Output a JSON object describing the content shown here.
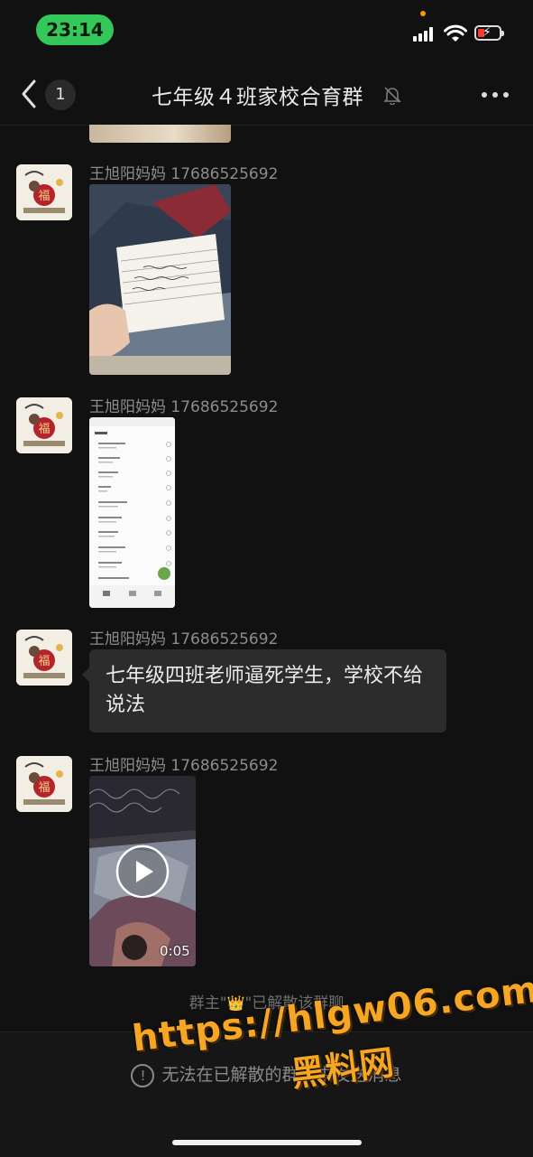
{
  "status_bar": {
    "time": "23:14",
    "signal_icon": "cellular-signal-icon",
    "wifi_icon": "wifi-icon",
    "battery_icon": "battery-charging-icon",
    "battery_color": "#ff3b30",
    "time_pill_color": "#34c759"
  },
  "nav": {
    "back_icon": "chevron-left-icon",
    "unread_count": "1",
    "title": "七年级４班家校合育群",
    "mute_icon": "bell-muted-icon",
    "more_icon": "more-dots-icon"
  },
  "messages": [
    {
      "type": "image",
      "sender": "王旭阳妈妈 17686525692",
      "content": "photo-of-handwritten-note"
    },
    {
      "type": "image",
      "sender": "王旭阳妈妈 17686525692",
      "content": "screenshot-of-call-log"
    },
    {
      "type": "text",
      "sender": "王旭阳妈妈 17686525692",
      "text": "七年级四班老师逼死学生，学校不给说法"
    },
    {
      "type": "video",
      "sender": "王旭阳妈妈 17686525692",
      "duration": "0:05"
    }
  ],
  "system_note": {
    "prefix": "群主\"",
    "crown": "👑",
    "suffix": "\"已解散该群聊"
  },
  "bottom": {
    "info_icon": "info-circle-icon",
    "disabled_text": "无法在已解散的群聊中发送消息"
  },
  "watermark": {
    "line1": "https://hlgw06.com",
    "line2": "黑料网"
  },
  "colors": {
    "background": "#111111",
    "bubble": "#2c2c2c",
    "watermark": "#f5a623"
  }
}
